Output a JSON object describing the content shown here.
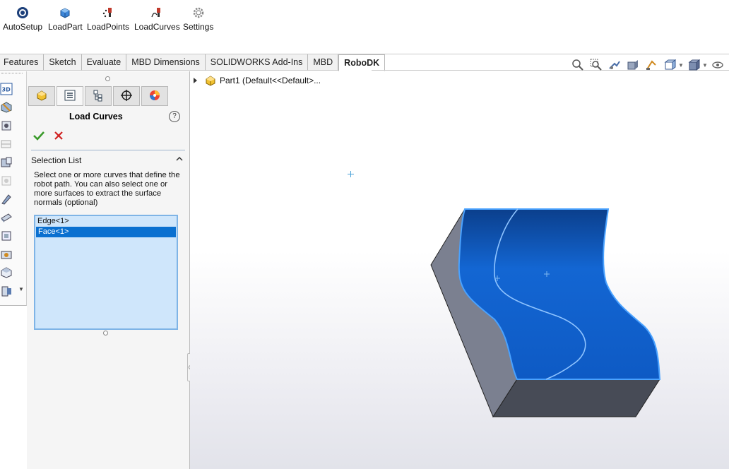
{
  "toolbar": {
    "buttons": [
      {
        "label": "AutoSetup",
        "icon": "robodk-autosetup-icon"
      },
      {
        "label": "LoadPart",
        "icon": "load-part-icon"
      },
      {
        "label": "LoadPoints",
        "icon": "load-points-icon"
      },
      {
        "label": "LoadCurves",
        "icon": "load-curves-icon"
      },
      {
        "label": "Settings",
        "icon": "gear-icon"
      }
    ]
  },
  "tabs": [
    {
      "label": "Features"
    },
    {
      "label": "Sketch"
    },
    {
      "label": "Evaluate"
    },
    {
      "label": "MBD Dimensions"
    },
    {
      "label": "SOLIDWORKS Add-Ins"
    },
    {
      "label": "MBD"
    },
    {
      "label": "RoboDK",
      "active": true
    }
  ],
  "property_manager": {
    "title": "Load Curves",
    "help_symbol": "?",
    "selection_section": {
      "title": "Selection List",
      "description": "Select one or more curves that define the robot path. You can also select one or more surfaces to extract the surface normals (optional)",
      "items": [
        {
          "label": "Edge<1>",
          "selected": false
        },
        {
          "label": "Face<1>",
          "selected": true
        }
      ]
    }
  },
  "feature_tree": {
    "part_label": "Part1  (Default<<Default>..."
  },
  "colors": {
    "accent": "#0a70d0",
    "face_blue": "#0f5bc4",
    "edge_highlight": "#4aa2ff",
    "side_gray": "#7a7f8e",
    "list_bg": "#cfe6fb",
    "ok_green": "#3a9a2a",
    "cancel_red": "#d02020"
  }
}
